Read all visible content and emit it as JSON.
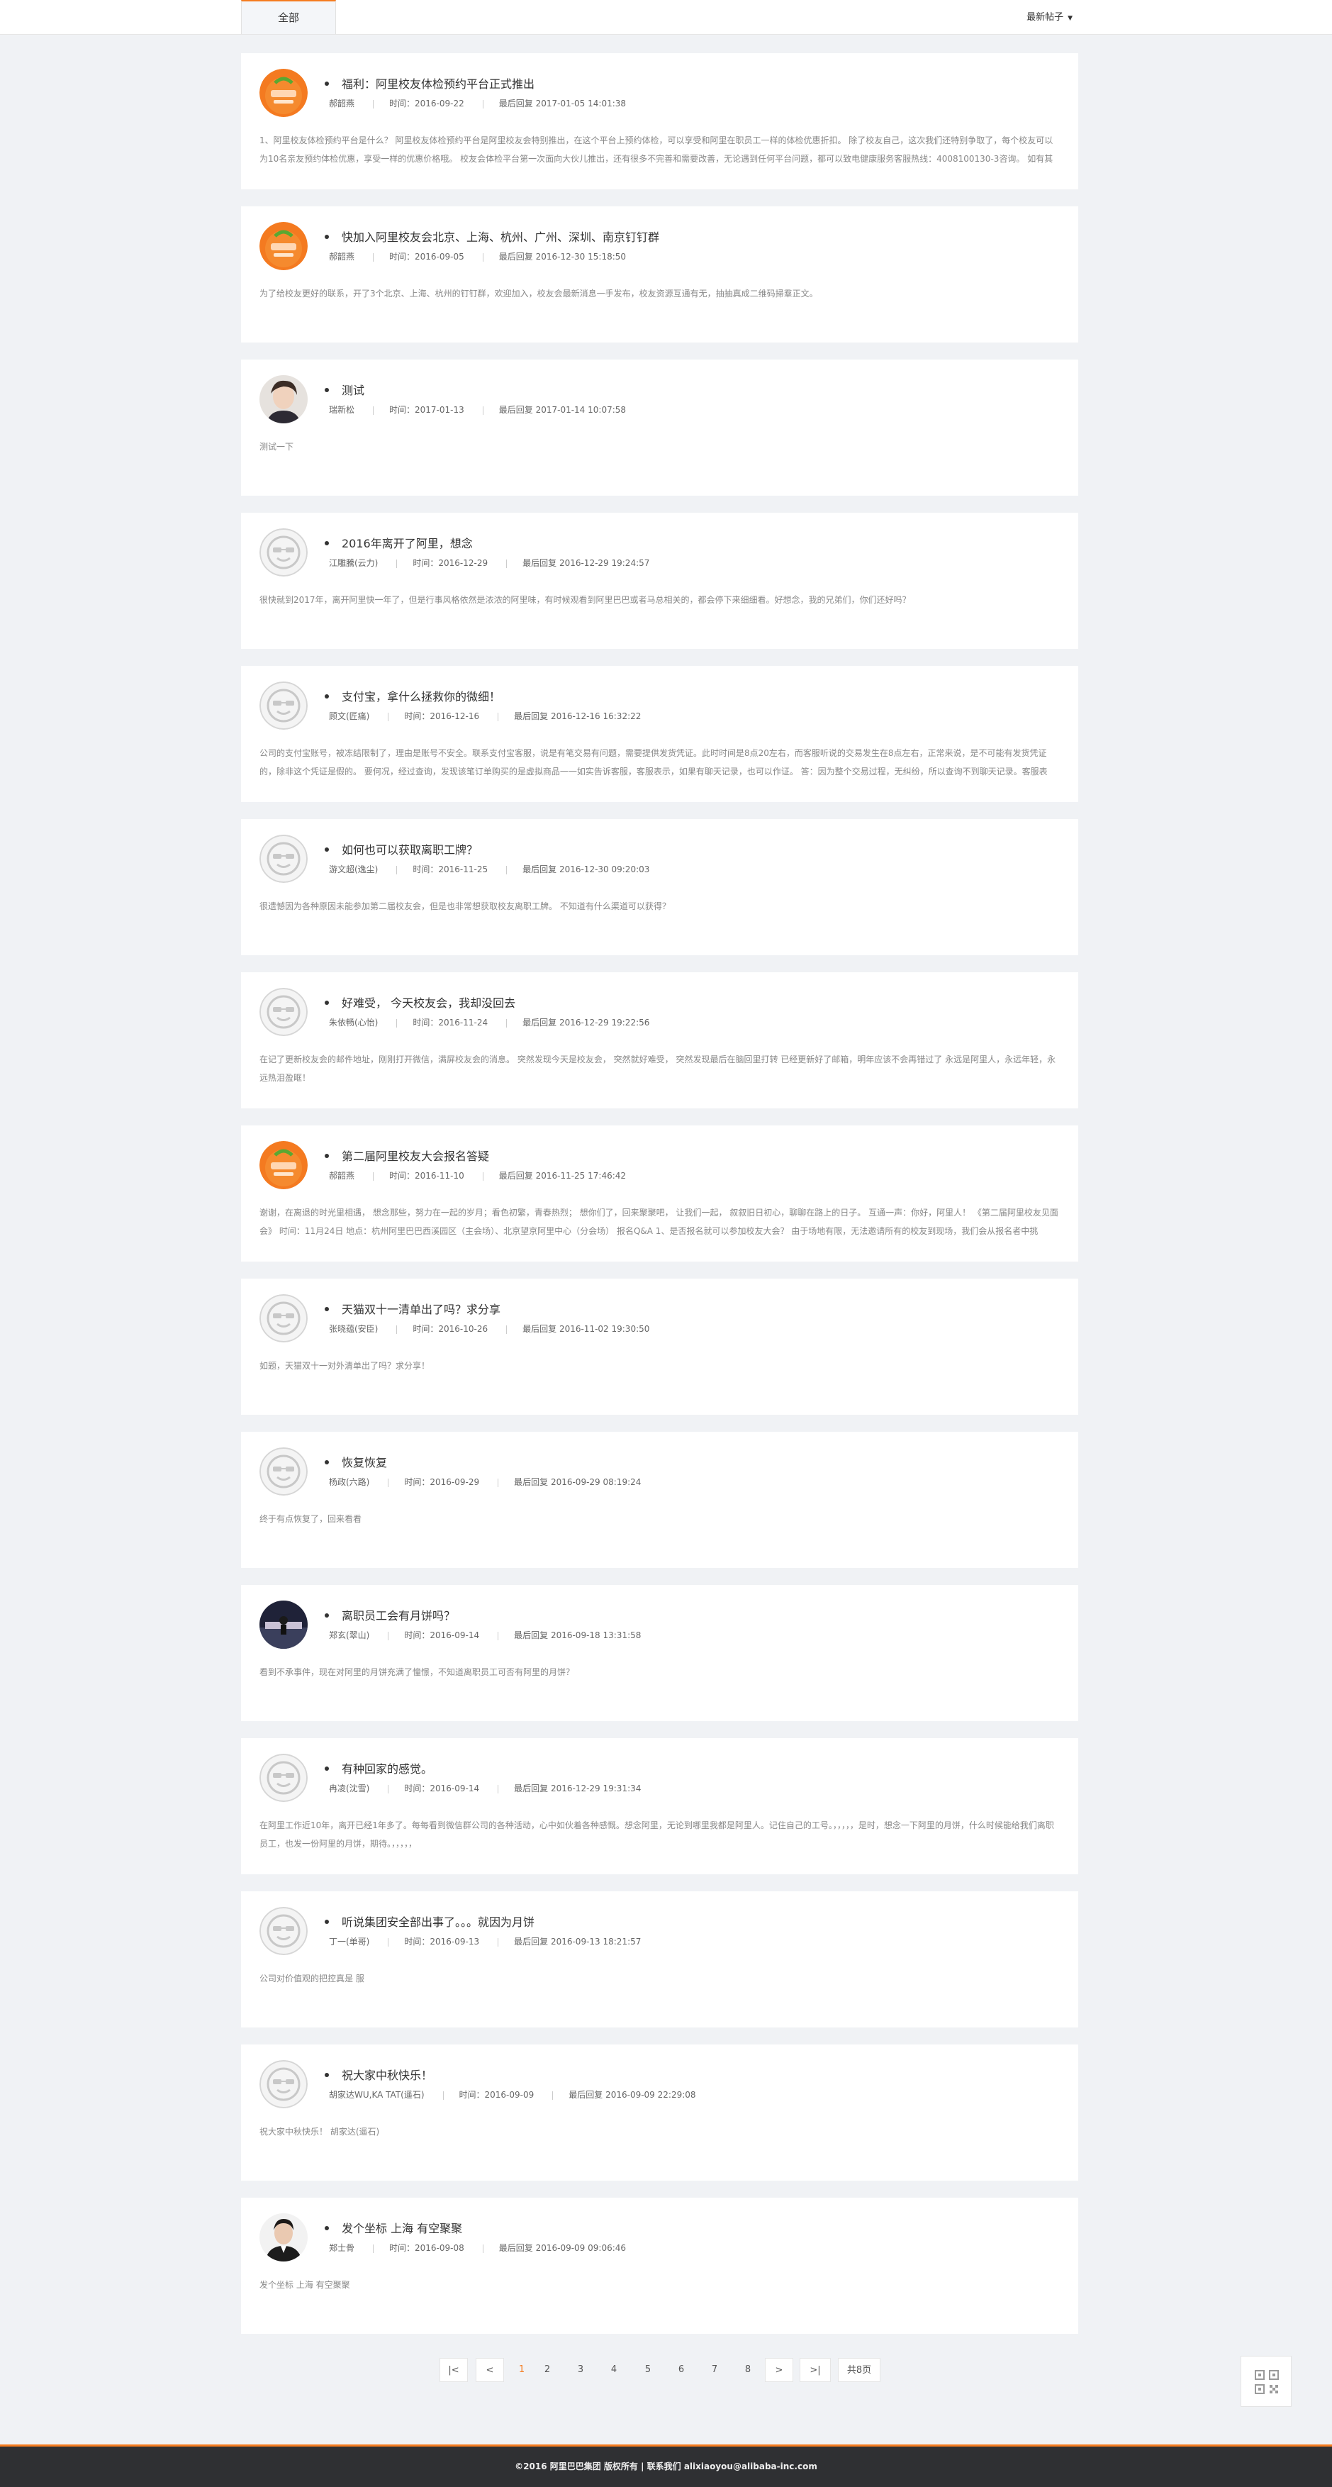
{
  "header": {
    "tab_all": "全部",
    "sort_label": "最新帖子"
  },
  "posts": [
    {
      "avatar": "orange-logo",
      "title": "福利：阿里校友体检预约平台正式推出",
      "author": "郝韶燕",
      "time": "时间：2016-09-22",
      "reply": "最后回复 2017-01-05 14:01:38",
      "excerpt": "1、阿里校友体检预约平台是什么？ 阿里校友体检预约平台是阿里校友会特别推出，在这个平台上预约体检，可以享受和阿里在职员工一样的体检优惠折扣。 除了校友自己，这次我们还特别争取了，每个校友可以为10名亲友预约体检优惠，享受一样的优惠价格哦。 校友会体检平台第一次面向大伙儿推出，还有很多不完善和需要改善，无论遇到任何平台问题，都可以致电健康服务客服热线：4008100130-3咨询。 如有其"
    },
    {
      "avatar": "orange-logo",
      "title": "快加入阿里校友会北京、上海、杭州、广州、深圳、南京钉钉群",
      "author": "郝韶燕",
      "time": "时间：2016-09-05",
      "reply": "最后回复 2016-12-30 15:18:50",
      "excerpt": "为了给校友更好的联系，开了3个北京、上海、杭州的钉钉群，欢迎加入，校友会最新消息一手发布，校友资源互通有无，抽抽真成二维码掃羣正文。"
    },
    {
      "avatar": "photo-man",
      "title": "测试",
      "author": "瑞新松",
      "time": "时间：2017-01-13",
      "reply": "最后回复 2017-01-14 10:07:58",
      "excerpt": "测试一下"
    },
    {
      "avatar": "default-face",
      "title": "2016年离开了阿里，想念",
      "author": "江雕騰(云力)",
      "time": "时间：2016-12-29",
      "reply": "最后回复 2016-12-29 19:24:57",
      "excerpt": "很快就到2017年，离开阿里快一年了，但是行事风格依然是浓浓的阿里味，有时候观看到阿里巴巴或者马总相关的，都会停下来细细看。好想念，我的兄弟们，你们还好吗？"
    },
    {
      "avatar": "default-face",
      "title": "支付宝，拿什么拯救你的微细！",
      "author": "顾文(匠痛)",
      "time": "时间：2016-12-16",
      "reply": "最后回复 2016-12-16 16:32:22",
      "excerpt": "公司的支付宝账号，被冻结限制了，理由是账号不安全。联系支付宝客服，说是有笔交易有问题，需要提供发货凭证。此时时间是8点20左右，而客服听说的交易发生在8点左右，正常来说，是不可能有发货凭证的，除非这个凭证是假的。 要何况，经过查询，发现该笔订单购买的是虚拟商品一一如实告诉客服，客服表示，如果有聊天记录，也可以作证。 答：因为整个交易过程，无纠纷，所以查询不到聊天记录。客服表"
    },
    {
      "avatar": "default-face",
      "title": "如何也可以获取离职工牌？",
      "author": "游文超(逸尘)",
      "time": "时间：2016-11-25",
      "reply": "最后回复 2016-12-30 09:20:03",
      "excerpt": "很遗憾因为各种原因未能参加第二届校友会，但是也非常想获取校友离职工牌。 不知道有什么渠道可以获得？"
    },
    {
      "avatar": "default-face",
      "title": "好难受， 今天校友会，我却没回去",
      "author": "朱依畅(心怡)",
      "time": "时间：2016-11-24",
      "reply": "最后回复 2016-12-29 19:22:56",
      "excerpt": "在记了更新校友会的邮件地址，刚刚打开微信，满屏校友会的消息。 突然发现今天是校友会， 突然就好难受， 突然发现最后在脑回里打转 已经更新好了邮箱，明年应该不会再错过了 永远是阿里人，永远年轻，永远热泪盈眶！"
    },
    {
      "avatar": "orange-logo",
      "title": "第二届阿里校友大会报名答疑",
      "author": "郝韶燕",
      "time": "时间：2016-11-10",
      "reply": "最后回复 2016-11-25 17:46:42",
      "excerpt": "谢谢，在离退的时光里相遇， 想念那些，努力在一起的岁月；看色初繁，青春热烈； 想你们了，回来聚聚吧， 让我们一起， 叙叙旧日初心，聊聊在路上的日子。 互通一声：你好，阿里人！ 《第二届阿里校友见面会》 时间：11月24日 地点：杭州阿里巴巴西溪园区（主会场）、北京望京阿里中心（分会场） 报名Q&A 1、是否报名就可以参加校友大会？ 由于场地有限，无法邀请所有的校友到现场，我们会从报名者中挑"
    },
    {
      "avatar": "default-face",
      "title": "天猫双十一清单出了吗？求分享",
      "author": "张晓蕴(安臣)",
      "time": "时间：2016-10-26",
      "reply": "最后回复 2016-11-02 19:30:50",
      "excerpt": "如题，天猫双十一对外清单出了吗？求分享！"
    },
    {
      "avatar": "default-face",
      "title": "恢复恢复",
      "author": "杨政(六路)",
      "time": "时间：2016-09-29",
      "reply": "最后回复 2016-09-29 08:19:24",
      "excerpt": "终于有点恢复了，回来看看"
    },
    {
      "avatar": "photo-dark",
      "title": "离职员工会有月饼吗？",
      "author": "郑玄(翠山)",
      "time": "时间：2016-09-14",
      "reply": "最后回复 2016-09-18 13:31:58",
      "excerpt": "看到不承事件，现在对阿里的月饼充满了憧憬，不知道离职员工可否有阿里的月饼？"
    },
    {
      "avatar": "default-face",
      "title": "有种回家的感觉。",
      "author": "冉凌(沈雪)",
      "time": "时间：2016-09-14",
      "reply": "最后回复 2016-12-29 19:31:34",
      "excerpt": "在阿里工作近10年，离开已经1年多了。每每看到微信群公司的各种活动，心中如伙着各种感慨。想念阿里，无论到哪里我都是阿里人。记住自己的工号。，，，，，是时，想念一下阿里的月饼，什么时候能给我们离职员工，也发一份阿里的月饼，期待。，，，，，"
    },
    {
      "avatar": "default-face",
      "title": "听说集团安全部出事了。。。就因为月饼",
      "author": "丁一(单哥)",
      "time": "时间：2016-09-13",
      "reply": "最后回复 2016-09-13 18:21:57",
      "excerpt": "公司对价值观的把控真是 服"
    },
    {
      "avatar": "default-face",
      "title": "祝大家中秋快乐！",
      "author": "胡家达WU,KA TAT(遥石)",
      "time": "时间：2016-09-09",
      "reply": "最后回复 2016-09-09 22:29:08",
      "excerpt": "祝大家中秋快乐！ 胡家达(遥石)"
    },
    {
      "avatar": "photo-suit",
      "title": "发个坐标 上海 有空聚聚",
      "author": "郑士骨",
      "time": "时间：2016-09-08",
      "reply": "最后回复 2016-09-09 09:06:46",
      "excerpt": "发个坐标 上海 有空聚聚"
    }
  ],
  "pagination": {
    "first": "|<",
    "prev": "<",
    "pages": [
      "1",
      "2",
      "3",
      "4",
      "5",
      "6",
      "7",
      "8"
    ],
    "current": "1",
    "next": ">",
    "last": ">|",
    "total": "共8页"
  },
  "footer": {
    "text": "©2016 阿里巴巴集团 版权所有 | 联系我们 alixiaoyou@alibaba-inc.com"
  },
  "icons": {
    "qr": "qr-code-icon",
    "sort_caret": "caret-down-icon"
  },
  "colors": {
    "accent": "#f57c1f",
    "footer_bg": "#2f3033"
  }
}
